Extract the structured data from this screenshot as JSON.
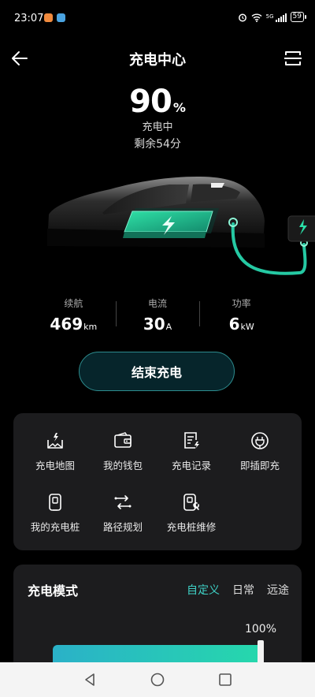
{
  "status_bar": {
    "time": "23:07",
    "battery": "59",
    "network": "5G",
    "app_icon_colors": [
      "#f08a3e",
      "#4aa3e0"
    ],
    "icons": [
      "alarm-icon",
      "wifi-icon",
      "signal-icon",
      "battery-icon"
    ]
  },
  "header": {
    "title": "充电中心",
    "back_icon": "arrow-left-icon",
    "menu_icon": "scan-icon"
  },
  "charging": {
    "percent": "90",
    "percent_unit": "%",
    "status": "充电中",
    "remaining": "剩余54分"
  },
  "stats": [
    {
      "label": "续航",
      "value": "469",
      "unit": "km"
    },
    {
      "label": "电流",
      "value": "30",
      "unit": "A"
    },
    {
      "label": "功率",
      "value": "6",
      "unit": "kW"
    }
  ],
  "stop_button": {
    "label": "结束充电"
  },
  "services": [
    {
      "label": "充电地图",
      "icon": "map-pin-icon"
    },
    {
      "label": "我的钱包",
      "icon": "wallet-icon"
    },
    {
      "label": "充电记录",
      "icon": "record-icon"
    },
    {
      "label": "即插即充",
      "icon": "plug-icon"
    },
    {
      "label": "我的充电桩",
      "icon": "charger-icon"
    },
    {
      "label": "路径规划",
      "icon": "route-icon"
    },
    {
      "label": "充电桩维修",
      "icon": "repair-icon"
    }
  ],
  "charge_mode": {
    "title": "充电模式",
    "tabs": [
      {
        "label": "自定义",
        "active": true
      },
      {
        "label": "日常",
        "active": false
      },
      {
        "label": "远途",
        "active": false
      }
    ],
    "limit_label": "100%",
    "limit_value": 1.0
  },
  "colors": {
    "accent": "#3ed0c5",
    "card": "#1c1c1e",
    "battery_green": "#1fb68a"
  },
  "nav_bar": {
    "icons": [
      "back-triangle-icon",
      "home-circle-icon",
      "recents-square-icon"
    ]
  }
}
